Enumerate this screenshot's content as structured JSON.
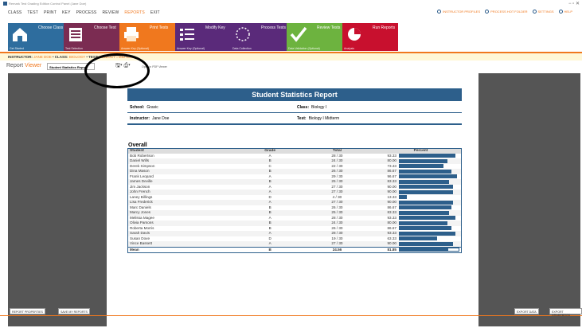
{
  "titlebar": {
    "text": "Remark Test Grading Edition Control Panel (Jane Doe)"
  },
  "menu": {
    "items": [
      "CLASS",
      "TEST",
      "PRINT",
      "KEY",
      "PROCESS",
      "REVIEW",
      "REPORTS",
      "EXIT"
    ],
    "active": "REPORTS"
  },
  "topright": {
    "items": [
      "INSTRUCTOR PROFILES",
      "PROCESS HOT FOLDER",
      "SETTINGS",
      "HELP"
    ]
  },
  "ribbon": {
    "tiles": [
      {
        "label": "Choose Class",
        "sub": "Get Started",
        "color": "#2e6d9e"
      },
      {
        "label": "Choose Test",
        "sub": "Test Selection",
        "color": "#7b2c52"
      },
      {
        "label": "Print Tests",
        "sub": "Answer Key (Optional)",
        "color": "#f0781e"
      },
      {
        "label": "Modify Key",
        "sub": "Answer Key (Optional)",
        "color": "#5a2a7a"
      },
      {
        "label": "Process Tests",
        "sub": "Data Collection",
        "color": "#5a2a7a"
      },
      {
        "label": "Review Tests",
        "sub": "Data Validation (Optional)",
        "color": "#6db33f"
      },
      {
        "label": "Run Reports",
        "sub": "Analysis",
        "color": "#c8102e"
      }
    ]
  },
  "instructor_bar": {
    "instructor_label": "INSTRUCTOR:",
    "instructor": "JANE DOE",
    "class_label": "CLASS:",
    "class": "BIOLOGY",
    "test_label": "TEST:",
    "test": "BIOLOGY I MIDTERM"
  },
  "viewer": {
    "title_part1": "Report",
    "title_part2": "Viewer",
    "report_select": "Student Statistics Report",
    "pdf_label": "Open in PDF Viewer"
  },
  "report": {
    "title": "Student Statistics Report",
    "school_label": "School:",
    "school": "Gravic",
    "class_label": "Class:",
    "class": "Biology I",
    "instructor_label": "Instructor:",
    "instructor": "Jane Doe",
    "test_label": "Test:",
    "test": "Biology I Midterm",
    "section": "Overall",
    "columns": [
      "Student",
      "Grade",
      "Total",
      "Percent"
    ],
    "rows": [
      {
        "student": "Bob Robertson",
        "grade": "A",
        "score": "28",
        "max": "30",
        "pct": "93.33",
        "frac": 0.9333
      },
      {
        "student": "Daniel Wills",
        "grade": "B",
        "score": "24",
        "max": "30",
        "pct": "80.00",
        "frac": 0.8
      },
      {
        "student": "Derek Simpson",
        "grade": "C",
        "score": "22",
        "max": "30",
        "pct": "73.33",
        "frac": 0.7333
      },
      {
        "student": "Dina Mason",
        "grade": "B",
        "score": "26",
        "max": "30",
        "pct": "86.67",
        "frac": 0.8667
      },
      {
        "student": "Frank Leopard",
        "grade": "A",
        "score": "29",
        "max": "30",
        "pct": "96.67",
        "frac": 0.9667
      },
      {
        "student": "James Deville",
        "grade": "B",
        "score": "25",
        "max": "30",
        "pct": "83.33",
        "frac": 0.8333
      },
      {
        "student": "Jim Jackson",
        "grade": "A",
        "score": "27",
        "max": "30",
        "pct": "90.00",
        "frac": 0.9
      },
      {
        "student": "John French",
        "grade": "A",
        "score": "27",
        "max": "30",
        "pct": "90.00",
        "frac": 0.9
      },
      {
        "student": "Laney Billings",
        "grade": "D",
        "score": "4",
        "max": "30",
        "pct": "13.33",
        "frac": 0.1333
      },
      {
        "student": "Lisa Frederick",
        "grade": "A",
        "score": "27",
        "max": "30",
        "pct": "90.00",
        "frac": 0.9
      },
      {
        "student": "Marc Daniels",
        "grade": "B",
        "score": "26",
        "max": "30",
        "pct": "86.67",
        "frac": 0.8667
      },
      {
        "student": "Marcy Jones",
        "grade": "B",
        "score": "25",
        "max": "30",
        "pct": "83.33",
        "frac": 0.8333
      },
      {
        "student": "Melissa Magee",
        "grade": "A",
        "score": "28",
        "max": "30",
        "pct": "93.33",
        "frac": 0.9333
      },
      {
        "student": "Olivia Parsons",
        "grade": "B",
        "score": "24",
        "max": "30",
        "pct": "80.00",
        "frac": 0.8
      },
      {
        "student": "Roberta Morris",
        "grade": "B",
        "score": "26",
        "max": "30",
        "pct": "86.67",
        "frac": 0.8667
      },
      {
        "student": "Sarah Davis",
        "grade": "A",
        "score": "28",
        "max": "30",
        "pct": "93.33",
        "frac": 0.9333
      },
      {
        "student": "Susan Dove",
        "grade": "D",
        "score": "19",
        "max": "30",
        "pct": "63.33",
        "frac": 0.6333
      },
      {
        "student": "Vince Bassett",
        "grade": "A",
        "score": "27",
        "max": "30",
        "pct": "90.00",
        "frac": 0.9
      }
    ],
    "mean": {
      "label": "Mean",
      "grade": "B",
      "total": "24.56",
      "pct": "81.85",
      "frac": 0.8185
    }
  },
  "buttons": {
    "report_properties": "REPORT PROPERTIES",
    "save_my_reports": "SAVE MY REPORTS",
    "export_data": "EXPORT DATA",
    "export_gradebook": "EXPORT GRADEBOOK"
  }
}
